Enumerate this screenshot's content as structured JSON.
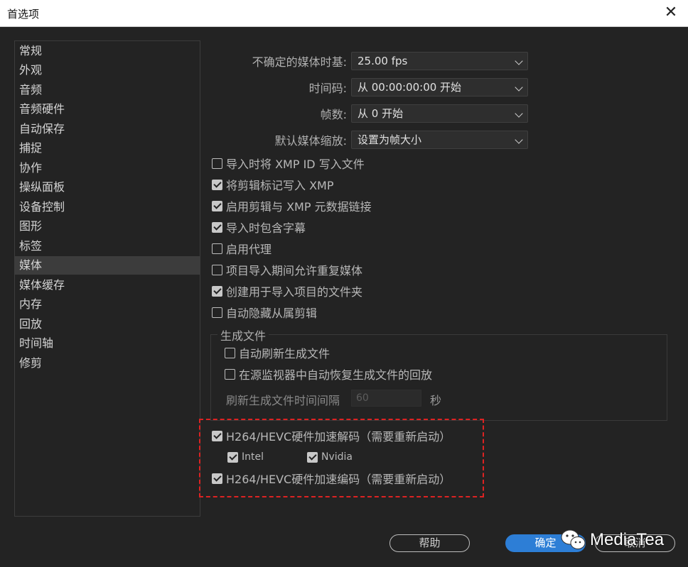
{
  "window": {
    "title": "首选项",
    "close_glyph": "✕"
  },
  "sidebar": {
    "items": [
      {
        "label": "常规"
      },
      {
        "label": "外观"
      },
      {
        "label": "音频"
      },
      {
        "label": "音频硬件"
      },
      {
        "label": "自动保存"
      },
      {
        "label": "捕捉"
      },
      {
        "label": "协作"
      },
      {
        "label": "操纵面板"
      },
      {
        "label": "设备控制"
      },
      {
        "label": "图形"
      },
      {
        "label": "标签"
      },
      {
        "label": "媒体"
      },
      {
        "label": "媒体缓存"
      },
      {
        "label": "内存"
      },
      {
        "label": "回放"
      },
      {
        "label": "时间轴"
      },
      {
        "label": "修剪"
      }
    ],
    "selected": "媒体"
  },
  "settings": {
    "timebase": {
      "label": "不确定的媒体时基:",
      "value": "25.00 fps"
    },
    "timecode": {
      "label": "时间码:",
      "value": "从 00:00:00:00 开始"
    },
    "frame_number": {
      "label": "帧数:",
      "value": "从 0 开始"
    },
    "scaling": {
      "label": "默认媒体缩放:",
      "value": "设置为帧大小"
    }
  },
  "checkboxes": {
    "write_xmp_id": {
      "label": "导入时将 XMP ID 写入文件",
      "checked": false
    },
    "write_clip_markers": {
      "label": "将剪辑标记写入 XMP",
      "checked": true
    },
    "enable_clip_xmp_link": {
      "label": "启用剪辑与 XMP 元数据链接",
      "checked": true
    },
    "include_captions": {
      "label": "导入时包含字幕",
      "checked": true
    },
    "enable_proxy": {
      "label": "启用代理",
      "checked": false
    },
    "allow_duplicate": {
      "label": "项目导入期间允许重复媒体",
      "checked": false
    },
    "create_folder": {
      "label": "创建用于导入项目的文件夹",
      "checked": true
    },
    "auto_hide_subclips": {
      "label": "自动隐藏从属剪辑",
      "checked": false
    }
  },
  "render_files": {
    "legend": "生成文件",
    "auto_refresh": {
      "label": "自动刷新生成文件",
      "checked": false
    },
    "auto_restore": {
      "label": "在源监视器中自动恢复生成文件的回放",
      "checked": false
    },
    "interval_label": "刷新生成文件时间间隔",
    "interval_value": "60",
    "interval_unit": "秒"
  },
  "hardware": {
    "decode": {
      "label": "H264/HEVC硬件加速解码（需要重新启动）",
      "checked": true
    },
    "intel": {
      "label": "Intel",
      "checked": true
    },
    "nvidia": {
      "label": "Nvidia",
      "checked": true
    },
    "encode": {
      "label": "H264/HEVC硬件加速编码（需要重新启动）",
      "checked": true
    }
  },
  "buttons": {
    "help": "帮助",
    "ok": "确定",
    "cancel": "取消"
  },
  "watermark": {
    "text": "MediaTea"
  },
  "colors": {
    "accent": "#2d7ed6",
    "highlight_border": "#dd2222",
    "background": "#232323"
  }
}
